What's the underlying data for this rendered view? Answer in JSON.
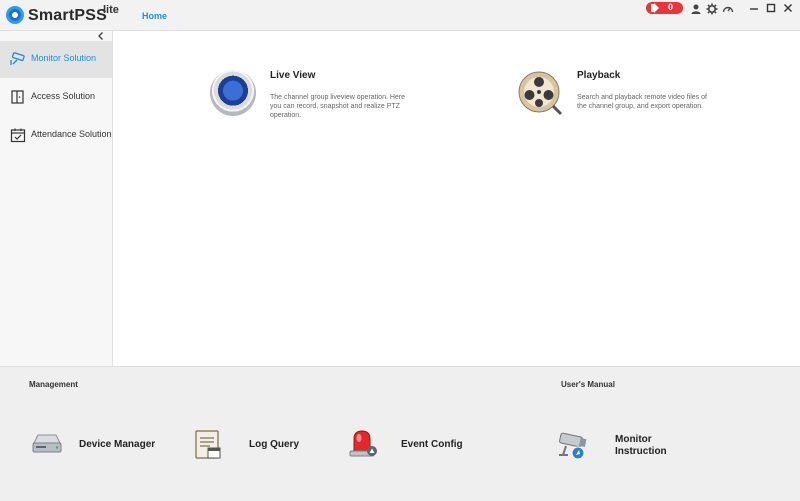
{
  "app": {
    "name": "SmartPSS",
    "suffix": "lite",
    "home_tab": "Home"
  },
  "titlebar": {
    "alarm_count": "0",
    "icons": [
      "user-icon",
      "settings-icon",
      "performance-icon"
    ],
    "window_controls": [
      "minimize",
      "maximize",
      "close"
    ]
  },
  "sidebar": {
    "items": [
      {
        "label": "Monitor Solution",
        "icon": "camera-icon",
        "active": true
      },
      {
        "label": "Access Solution",
        "icon": "door-icon",
        "active": false
      },
      {
        "label": "Attendance Solution",
        "icon": "calendar-check-icon",
        "active": false
      }
    ]
  },
  "main": {
    "features": [
      {
        "title": "Live View",
        "description": "The channel group liveview operation. Here you can record, snapshot and realize PTZ operation.",
        "icon": "live-view-icon"
      },
      {
        "title": "Playback",
        "description": "Search and playback remote video files of the channel group, and export operation.",
        "icon": "film-reel-icon"
      }
    ]
  },
  "bottom": {
    "management_title": "Management",
    "manual_title": "User's Manual",
    "tools": [
      {
        "label": "Device Manager",
        "icon": "device-icon"
      },
      {
        "label": "Log Query",
        "icon": "log-icon"
      },
      {
        "label": "Event Config",
        "icon": "alarm-light-icon"
      }
    ],
    "manual_item": {
      "line1": "Monitor",
      "line2": "Instruction",
      "icon": "cctv-camera-icon"
    }
  },
  "colors": {
    "accent": "#1a8fd8",
    "alarm": "#e8363b"
  }
}
